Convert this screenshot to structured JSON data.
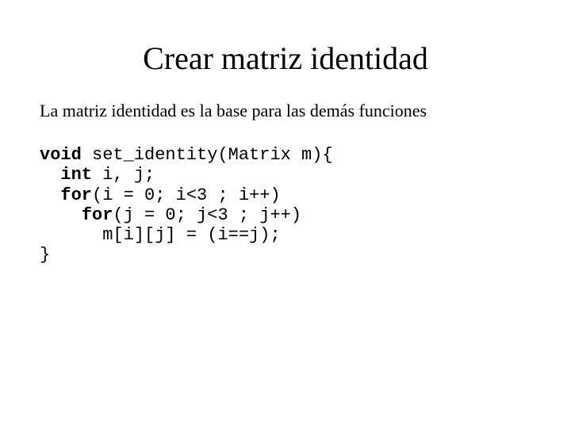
{
  "slide": {
    "title": "Crear matriz identidad",
    "subtitle": "La matriz identidad es la base para las demás funciones",
    "code": {
      "kw_void": "void",
      "line1_rest": " set_identity(Matrix m){",
      "indent1": "  ",
      "kw_int": "int",
      "line2_rest": " i, j;",
      "kw_for1": "for",
      "line3_rest": "(i = 0; i<3 ; i++)",
      "indent2": "    ",
      "kw_for2": "for",
      "line4_rest": "(j = 0; j<3 ; j++)",
      "indent3": "      ",
      "line5": "m[i][j] = (i==j);",
      "line6": "}"
    }
  }
}
